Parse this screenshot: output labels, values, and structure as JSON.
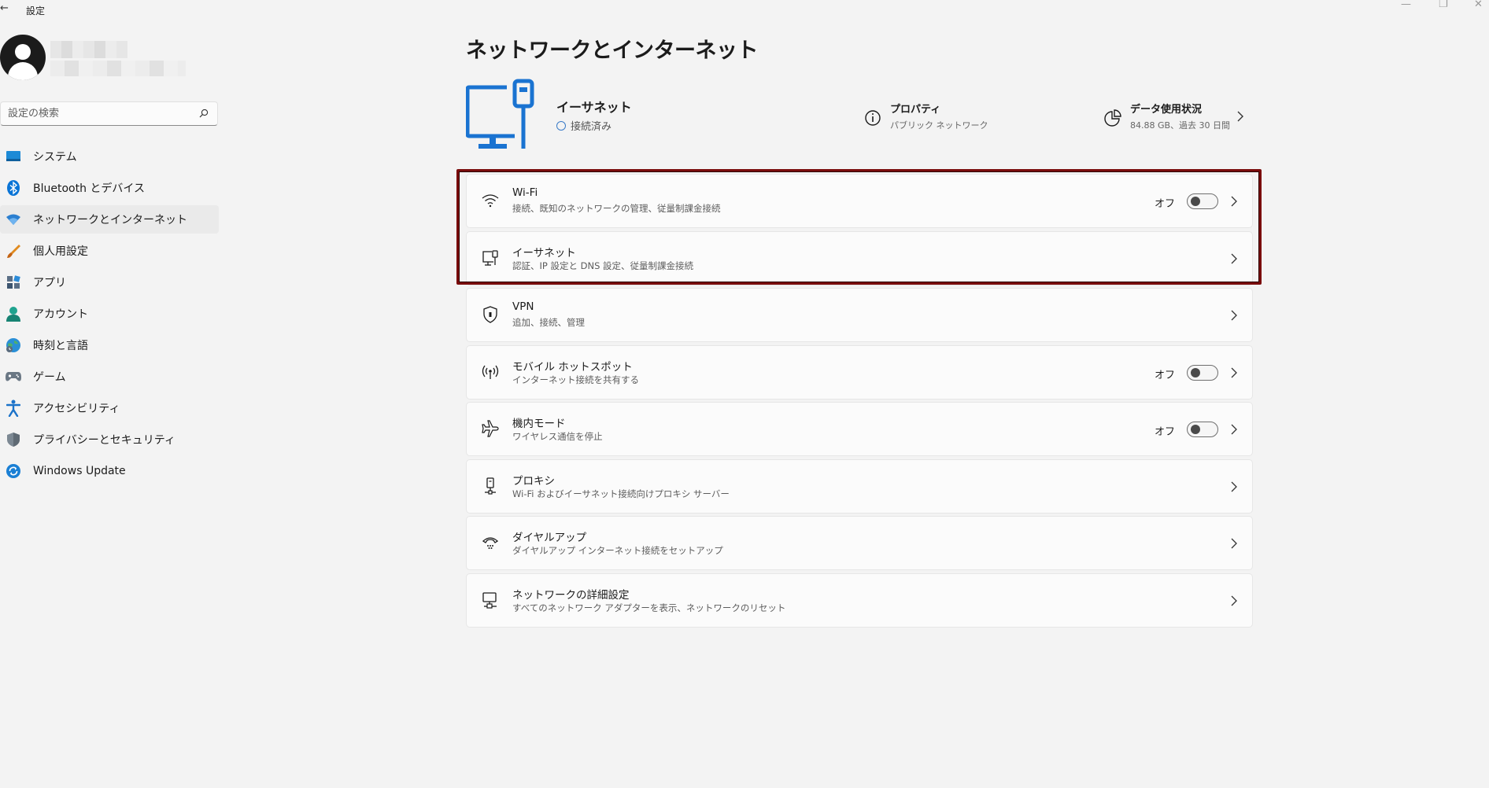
{
  "window": {
    "back_glyph": "←",
    "title": "設定",
    "controls": {
      "minimize": "—",
      "maximize": "❐",
      "close": "✕"
    }
  },
  "sidebar": {
    "search": {
      "placeholder": "設定の検索",
      "value": ""
    },
    "items": [
      {
        "label": "システム",
        "icon": "system-icon",
        "active": false
      },
      {
        "label": "Bluetooth とデバイス",
        "icon": "bluetooth-icon",
        "active": false
      },
      {
        "label": "ネットワークとインターネット",
        "icon": "network-wifi-icon",
        "active": true
      },
      {
        "label": "個人用設定",
        "icon": "brush-icon",
        "active": false
      },
      {
        "label": "アプリ",
        "icon": "apps-icon",
        "active": false
      },
      {
        "label": "アカウント",
        "icon": "account-icon",
        "active": false
      },
      {
        "label": "時刻と言語",
        "icon": "time-language-icon",
        "active": false
      },
      {
        "label": "ゲーム",
        "icon": "gamepad-icon",
        "active": false
      },
      {
        "label": "アクセシビリティ",
        "icon": "accessibility-icon",
        "active": false
      },
      {
        "label": "プライバシーとセキュリティ",
        "icon": "shield-icon",
        "active": false
      },
      {
        "label": "Windows Update",
        "icon": "windows-update-icon",
        "active": false
      }
    ]
  },
  "main": {
    "title": "ネットワークとインターネット",
    "connection": {
      "name": "イーサネット",
      "status": "接続済み"
    },
    "properties": {
      "title": "プロパティ",
      "subtitle": "パブリック ネットワーク"
    },
    "data_usage": {
      "title": "データ使用状況",
      "subtitle": "84.88 GB、過去 30 日間"
    },
    "rows": [
      {
        "title": "Wi-Fi",
        "subtitle": "接続、既知のネットワークの管理、従量制課金接続",
        "state": "オフ",
        "toggle": false,
        "icon": "wifi-icon"
      },
      {
        "title": "イーサネット",
        "subtitle": "認証、IP 設定と DNS 設定、従量制課金接続",
        "icon": "ethernet-icon"
      },
      {
        "title": "VPN",
        "subtitle": "追加、接続、管理",
        "icon": "vpn-shield-icon"
      },
      {
        "title": "モバイル ホットスポット",
        "subtitle": "インターネット接続を共有する",
        "state": "オフ",
        "toggle": false,
        "icon": "hotspot-icon"
      },
      {
        "title": "機内モード",
        "subtitle": "ワイヤレス通信を停止",
        "state": "オフ",
        "toggle": false,
        "icon": "airplane-icon"
      },
      {
        "title": "プロキシ",
        "subtitle": "Wi-Fi およびイーサネット接続向けプロキシ サーバー",
        "icon": "proxy-icon"
      },
      {
        "title": "ダイヤルアップ",
        "subtitle": "ダイヤルアップ インターネット接続をセットアップ",
        "icon": "dialup-icon"
      },
      {
        "title": "ネットワークの詳細設定",
        "subtitle": "すべてのネットワーク アダプターを表示、ネットワークのリセット",
        "icon": "advanced-network-icon"
      }
    ]
  },
  "colors": {
    "accent": "#0067c0",
    "highlight_border": "#7a0c0c",
    "background": "#f3f3f3",
    "card": "#fbfbfb"
  }
}
